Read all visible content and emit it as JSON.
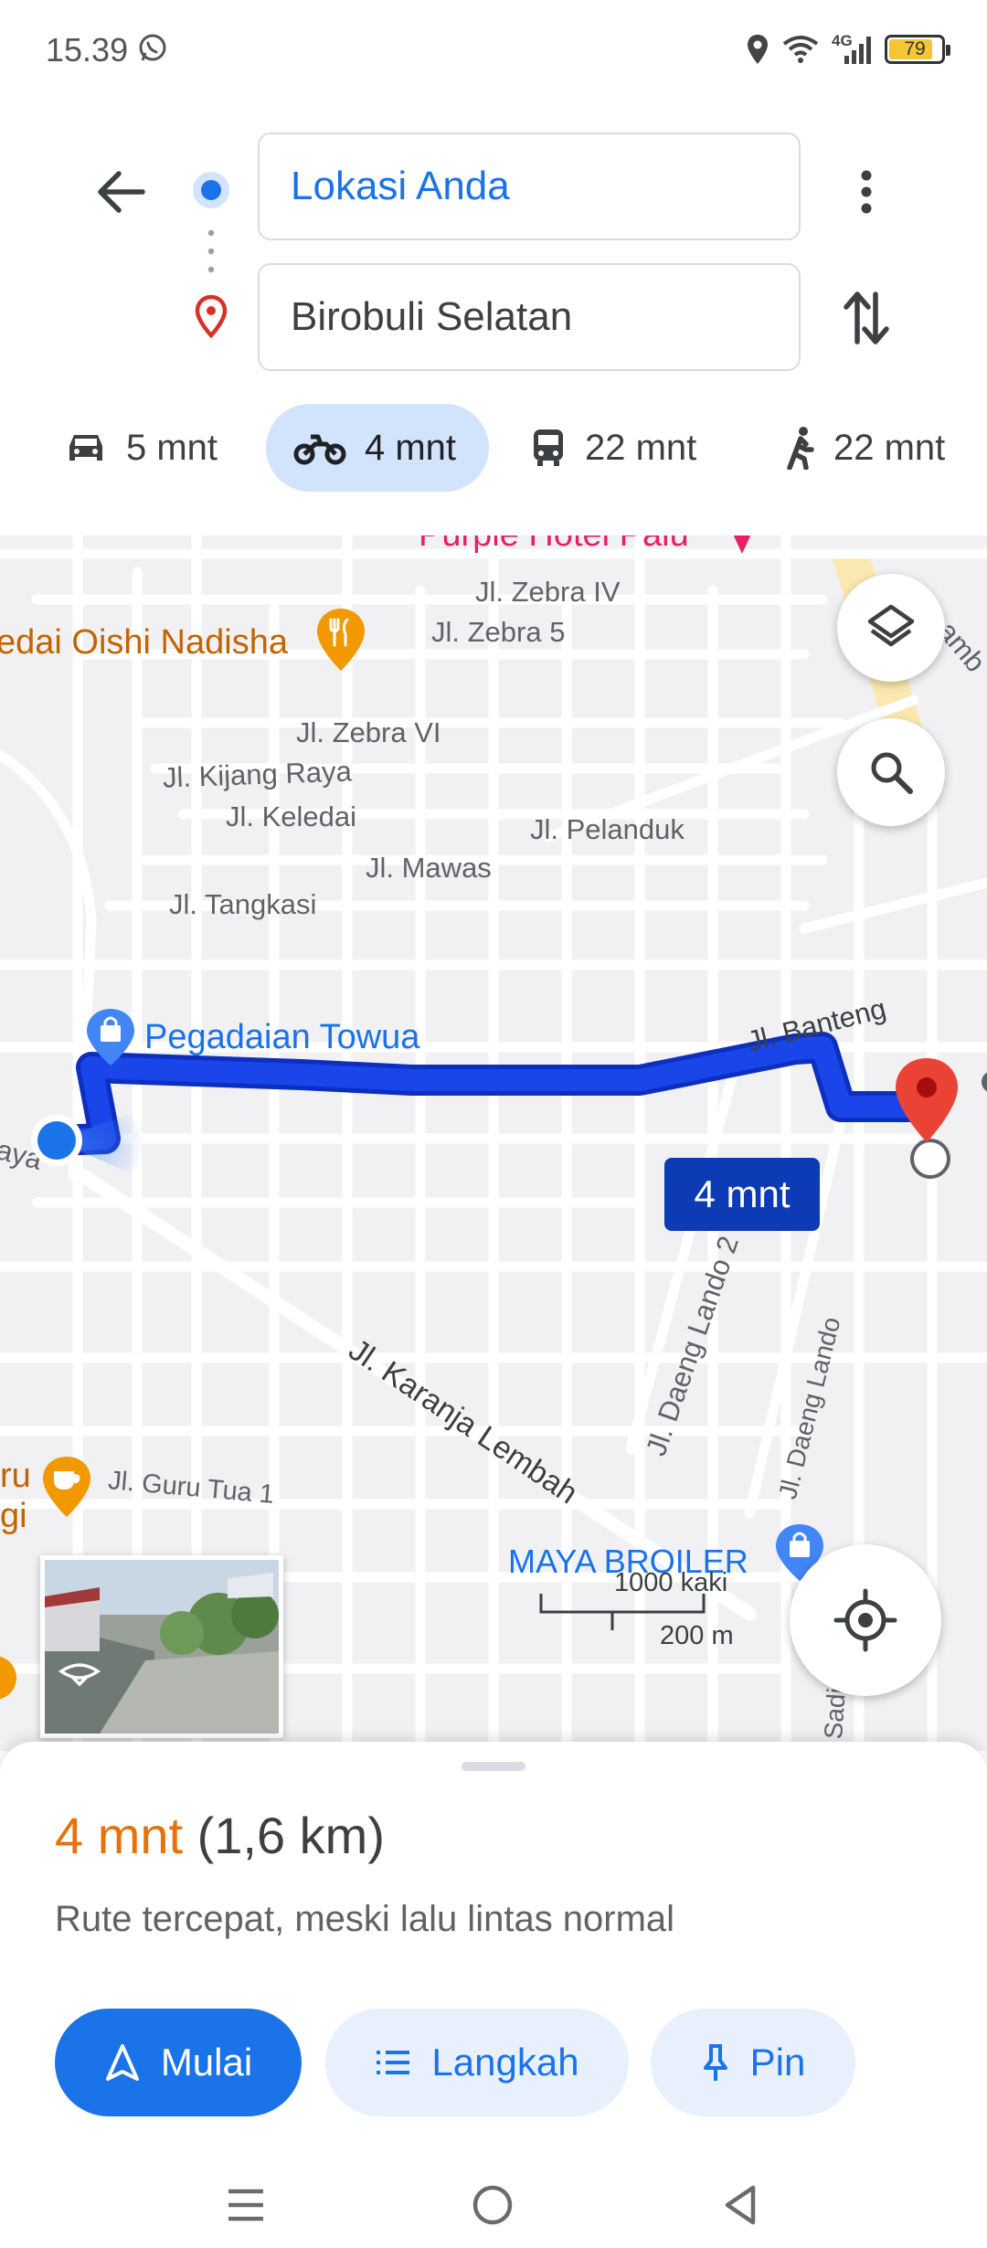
{
  "status_bar": {
    "time": "15.39",
    "network": "4G",
    "battery": "79",
    "battery_fraction": 0.79,
    "icons": [
      "whatsapp-icon",
      "location-icon",
      "wifi-icon",
      "signal-icon",
      "battery-icon"
    ]
  },
  "header": {
    "origin": "Lokasi Anda",
    "destination": "Birobuli Selatan",
    "icons": [
      "back-arrow-icon",
      "origin-dot-icon",
      "destination-pin-icon",
      "more-vert-icon",
      "swap-icon"
    ]
  },
  "travel_modes": [
    {
      "name": "car",
      "label": "5 mnt",
      "icon": "car-icon"
    },
    {
      "name": "motorcycle",
      "label": "4 mnt",
      "icon": "motorcycle-icon",
      "selected": true
    },
    {
      "name": "transit",
      "label": "22 mnt",
      "icon": "bus-icon"
    },
    {
      "name": "walk",
      "label": "22 mnt",
      "icon": "walk-icon"
    }
  ],
  "map": {
    "streets": {
      "zebra4": "Jl. Zebra IV",
      "zebra5": "Jl. Zebra 5",
      "zebra6": "Jl. Zebra VI",
      "kijang": "Jl. Kijang Raya",
      "keledai": "Jl. Keledai",
      "pelanduk": "Jl. Pelanduk",
      "mawas": "Jl. Mawas",
      "tangkasi": "Jl. Tangkasi",
      "banteng": "Jl. Banteng",
      "karanja": "Jl. Karanja Lembah",
      "daeng2": "Jl. Daeng Lando 2",
      "daeng": "Jl. Daeng Lando",
      "guru": "Jl. Guru Tua 1"
    },
    "pois": {
      "hotel": "Purple Hotel Palu",
      "kedai": "edai Oishi Nadisha",
      "pegadaian": "Pegadaian Towua",
      "maya": "MAYA BROILER"
    },
    "edge_fragments": {
      "left_raya": "aya",
      "left_ru": "ru",
      "left_gi": "gi",
      "right_pamb": "amb",
      "bottom_sadi": "Sadi"
    },
    "route_eta": "4 mnt",
    "scale": {
      "imperial": "1000 kaki",
      "metric": "200 m"
    },
    "colors": {
      "route": "#1a45e8",
      "route_outline": "#0d2fc0",
      "chip": "#0d3bb5",
      "pin": "#ea4335",
      "food_poi": "#f29900",
      "shop_poi": "#4285f4"
    },
    "controls": [
      "layers-icon",
      "search-icon",
      "my-location-icon",
      "street-view-icon"
    ]
  },
  "sheet": {
    "duration": "4 mnt",
    "distance": "(1,6 km)",
    "description": "Rute tercepat, meski lalu lintas normal",
    "buttons": {
      "start": "Mulai",
      "steps": "Langkah",
      "pin": "Pin"
    }
  },
  "nav_bar": {
    "icons": [
      "menu-icon",
      "home-icon",
      "back-icon"
    ]
  }
}
